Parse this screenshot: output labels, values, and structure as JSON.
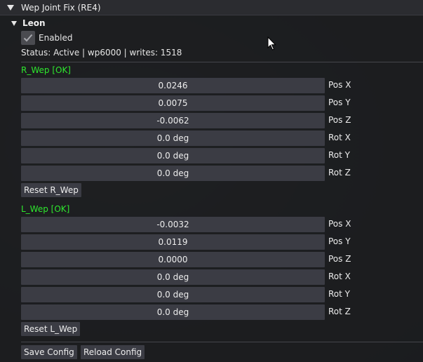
{
  "window": {
    "title": "Wep Joint Fix (RE4)"
  },
  "tree": {
    "node_label": "Leon"
  },
  "enabled": {
    "label": "Enabled",
    "checked": true
  },
  "status_text": "Status: Active | wp6000 | writes: 1518",
  "r_wep": {
    "header": "R_Wep [OK]",
    "rows": [
      {
        "value": "0.0246",
        "label": "Pos X"
      },
      {
        "value": "0.0075",
        "label": "Pos Y"
      },
      {
        "value": "-0.0062",
        "label": "Pos Z"
      },
      {
        "value": "0.0 deg",
        "label": "Rot X"
      },
      {
        "value": "0.0 deg",
        "label": "Rot Y"
      },
      {
        "value": "0.0 deg",
        "label": "Rot Z"
      }
    ],
    "reset_label": "Reset R_Wep"
  },
  "l_wep": {
    "header": "L_Wep [OK]",
    "rows": [
      {
        "value": "-0.0032",
        "label": "Pos X"
      },
      {
        "value": "0.0119",
        "label": "Pos Y"
      },
      {
        "value": "0.0000",
        "label": "Pos Z"
      },
      {
        "value": "0.0 deg",
        "label": "Rot X"
      },
      {
        "value": "0.0 deg",
        "label": "Rot Y"
      },
      {
        "value": "0.0 deg",
        "label": "Rot Z"
      }
    ],
    "reset_label": "Reset L_Wep"
  },
  "footer": {
    "save_label": "Save Config",
    "reload_label": "Reload Config"
  },
  "colors": {
    "header_green": "#2ee82e",
    "widget_bg": "#3b3c44",
    "titlebar_bg": "#2b2c30"
  }
}
